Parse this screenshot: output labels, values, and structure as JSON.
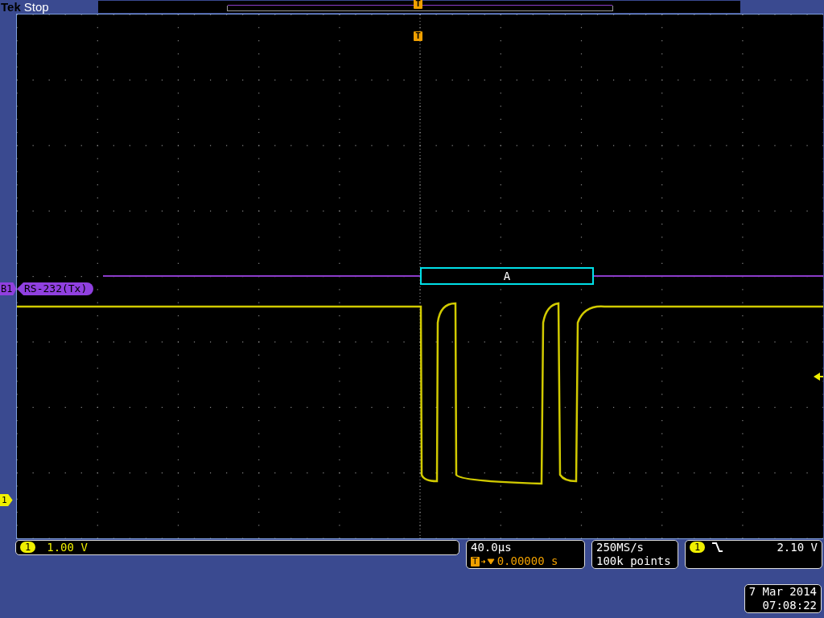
{
  "header": {
    "brand": "Tek",
    "status": "Stop"
  },
  "record_view": {
    "trigger_marker": "T"
  },
  "display": {
    "trigger_marker": "T",
    "channel_marker": "1"
  },
  "bus": {
    "marker": "B1",
    "label": "RS-232(Tx)",
    "packets": [
      {
        "value": "A"
      }
    ]
  },
  "readouts": {
    "channel": {
      "badge": "1",
      "scale": "1.00 V"
    },
    "timebase": {
      "scale": "40.0µs",
      "trigger_badge": "T",
      "position": "0.00000 s"
    },
    "acquisition": {
      "rate": "250MS/s",
      "length": "100k points"
    },
    "trigger": {
      "badge": "1",
      "falling_edge": true,
      "level": "2.10 V"
    }
  },
  "datetime": {
    "date": "7 Mar 2014",
    "time": "07:08:22"
  }
}
